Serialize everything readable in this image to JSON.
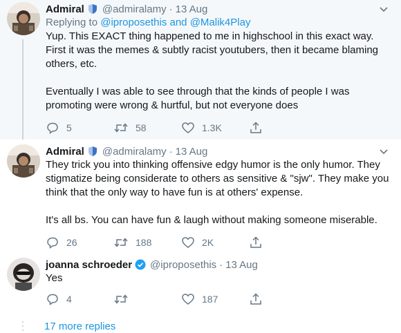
{
  "tweets": [
    {
      "name": "Admiral",
      "handle": "@admiralamy",
      "date": "13 Aug",
      "reply_prefix": "Replying to ",
      "reply_mention_1": "@iproposethis",
      "reply_and": " and ",
      "reply_mention_2": "@Malik4Play",
      "text_1": "Yup. This EXACT thing happened to me in highschool in this exact way. First it was the memes & subtly racist youtubers, then it became blaming others, etc.",
      "text_2": "Eventually I was able to see through that the kinds of people I was promoting were wrong & hurtful, but not everyone does",
      "replies": "5",
      "retweets": "58",
      "likes": "1.3K",
      "badge": "shield-badge-icon"
    },
    {
      "name": "Admiral",
      "handle": "@admiralamy",
      "date": "13 Aug",
      "text_1": "They trick you into thinking offensive edgy humor is the only humor. They stigmatize being considerate to others as sensitive & \"sjw\". They make you think that the only way to have fun is at others' expense.",
      "text_2": "It's all bs. You can have fun & laugh without making someone miserable.",
      "replies": "26",
      "retweets": "188",
      "likes": "2K",
      "badge": "shield-badge-icon"
    },
    {
      "name": "joanna schroeder",
      "handle": "@iproposethis",
      "date": "13 Aug",
      "text_1": "Yes",
      "replies": "4",
      "retweets": "",
      "likes": "187",
      "badge": "verified-badge-icon"
    }
  ],
  "separator": "·",
  "more_replies": "17 more replies",
  "colors": {
    "link": "#1b95e0",
    "muted": "#657786",
    "highlight_bg": "#f5f8fa",
    "verified": "#1da1f2",
    "shield": "#3b74c4"
  }
}
